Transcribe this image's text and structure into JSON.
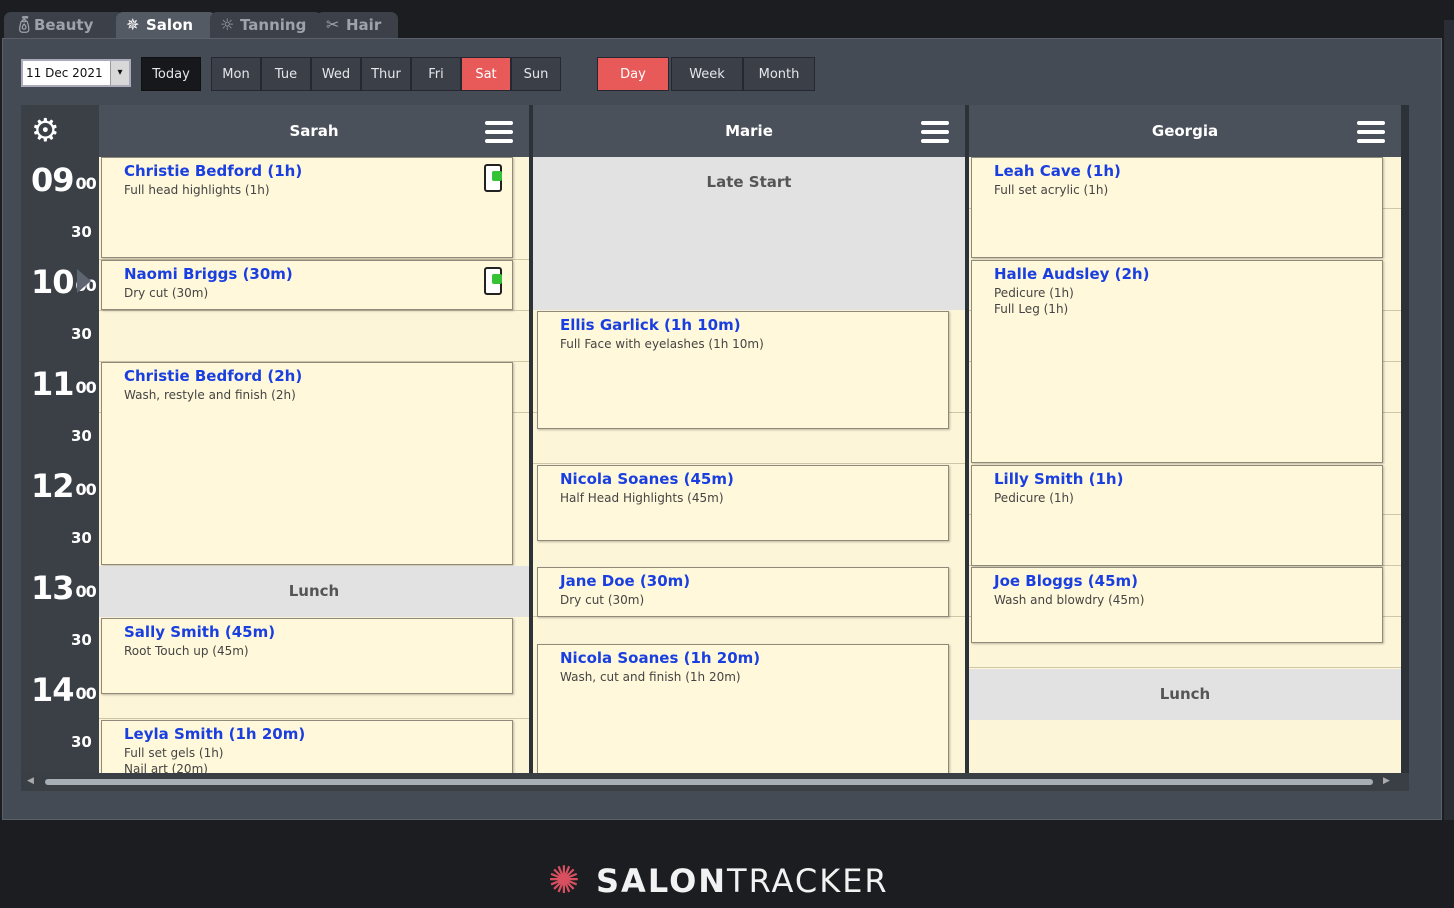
{
  "tabs": [
    {
      "label": "Beauty",
      "icon": "bottle-icon"
    },
    {
      "label": "Salon",
      "icon": "sparkle-icon"
    },
    {
      "label": "Tanning",
      "icon": "sun-icon"
    },
    {
      "label": "Hair",
      "icon": "scissors-icon"
    }
  ],
  "toolbar": {
    "date": "11 Dec 2021",
    "today": "Today",
    "days": [
      "Mon",
      "Tue",
      "Wed",
      "Thur",
      "Fri",
      "Sat",
      "Sun"
    ],
    "selected_day": "Sat",
    "views": [
      "Day",
      "Week",
      "Month"
    ],
    "selected_view": "Day"
  },
  "times": {
    "hours": [
      "09",
      "10",
      "11",
      "12",
      "13",
      "14"
    ],
    "minutes": "00",
    "half": "30"
  },
  "staff": [
    {
      "name": "Sarah"
    },
    {
      "name": "Marie"
    },
    {
      "name": "Georgia"
    }
  ],
  "sarah": {
    "a1": {
      "name": "Christie Bedford (1h)",
      "s1": "Full head highlights (1h)"
    },
    "a2": {
      "name": "Naomi Briggs (30m)",
      "s1": "Dry cut (30m)"
    },
    "a3": {
      "name": "Christie Bedford (2h)",
      "s1": "Wash, restyle and finish (2h)"
    },
    "lunch": "Lunch",
    "a4": {
      "name": "Sally Smith (45m)",
      "s1": "Root Touch up (45m)"
    },
    "a5": {
      "name": "Leyla Smith (1h 20m)",
      "s1": "Full set gels (1h)",
      "s2": "Nail art (20m)"
    }
  },
  "marie": {
    "late": "Late Start",
    "a1": {
      "name": "Ellis Garlick (1h 10m)",
      "s1": "Full Face with eyelashes (1h 10m)"
    },
    "a2": {
      "name": "Nicola Soanes (45m)",
      "s1": "Half Head Highlights  (45m)"
    },
    "a3": {
      "name": "Jane Doe (30m)",
      "s1": "Dry cut (30m)"
    },
    "a4": {
      "name": "Nicola Soanes (1h 20m)",
      "s1": "Wash, cut and finish (1h 20m)"
    }
  },
  "georgia": {
    "a1": {
      "name": "Leah Cave (1h)",
      "s1": "Full set acrylic (1h)"
    },
    "a2": {
      "name": "Halle Audsley (2h)",
      "s1": "Pedicure (1h)",
      "s2": "Full Leg (1h)"
    },
    "a3": {
      "name": "Lilly Smith (1h)",
      "s1": "Pedicure (1h)"
    },
    "a4": {
      "name": "Joe Bloggs (45m)",
      "s1": "Wash and blowdry (45m)"
    },
    "lunch": "Lunch"
  },
  "branding": {
    "part1": "SALON",
    "part2": "TRACKER"
  },
  "colors": {
    "accent_red": "#e85a5a",
    "appt_name": "#1a3fe0",
    "appt_bg": "#fff8da",
    "column_bg": "#fdf5d8"
  }
}
